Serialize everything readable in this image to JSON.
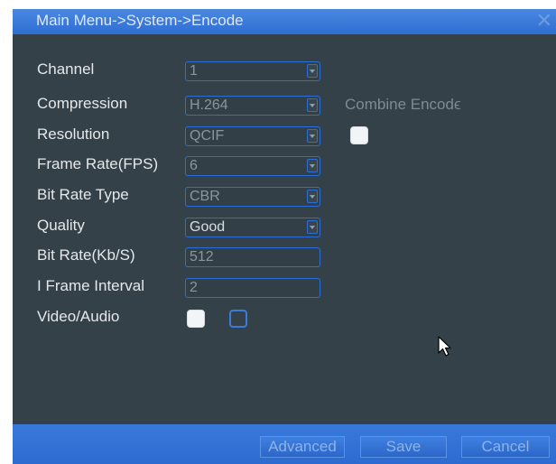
{
  "window": {
    "title": "Main Menu->System->Encode",
    "close_glyph": "✕"
  },
  "form": {
    "channel": {
      "label": "Channel",
      "value": "1"
    },
    "compression": {
      "label": "Compression",
      "value": "H.264"
    },
    "resolution": {
      "label": "Resolution",
      "value": "QCIF"
    },
    "frame_rate": {
      "label": "Frame Rate(FPS)",
      "value": "6"
    },
    "bit_rate_type": {
      "label": "Bit Rate Type",
      "value": "CBR"
    },
    "quality": {
      "label": "Quality",
      "value": "Good"
    },
    "bit_rate": {
      "label": "Bit Rate(Kb/S)",
      "value": "512"
    },
    "i_frame_interval": {
      "label": "I Frame Interval",
      "value": "2"
    },
    "video_audio": {
      "label": "Video/Audio",
      "video_checked": true,
      "audio_checked": false
    }
  },
  "combine_encode": {
    "label": "Combine Encodϵ",
    "checked": true
  },
  "buttons": {
    "advanced": "Advanced",
    "save": "Save",
    "cancel": "Cancel"
  },
  "colors": {
    "panel_bg": "#354148",
    "accent_blue": "#2f6ed2",
    "field_border": "#2a6fd6"
  }
}
